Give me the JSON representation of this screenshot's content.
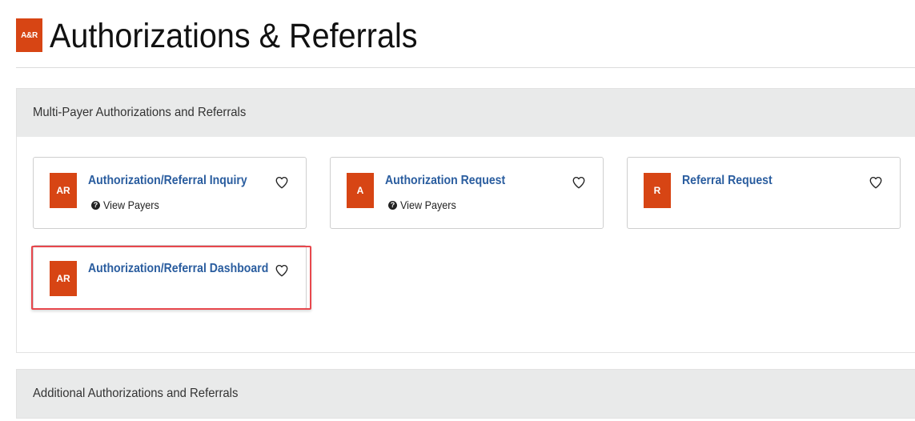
{
  "header": {
    "logo_text": "A&R",
    "title": "Authorizations & Referrals"
  },
  "sections": [
    {
      "title": "Multi-Payer Authorizations and Referrals",
      "tiles": [
        {
          "badge": "AR",
          "title": "Authorization/Referral Inquiry",
          "sub": "View Payers"
        },
        {
          "badge": "A",
          "title": "Authorization Request",
          "sub": "View Payers"
        },
        {
          "badge": "R",
          "title": "Referral Request",
          "sub": ""
        },
        {
          "badge": "AR",
          "title": "Authorization/Referral Dashboard",
          "sub": ""
        }
      ]
    },
    {
      "title": "Additional Authorizations and Referrals"
    }
  ],
  "icons": {
    "favorite": "heart-outline-icon",
    "help": "question-circle-icon"
  },
  "colors": {
    "badge": "#d74514",
    "link": "#2a5d9f",
    "highlight": "#e8474d",
    "section_header_bg": "#e9eaea"
  }
}
